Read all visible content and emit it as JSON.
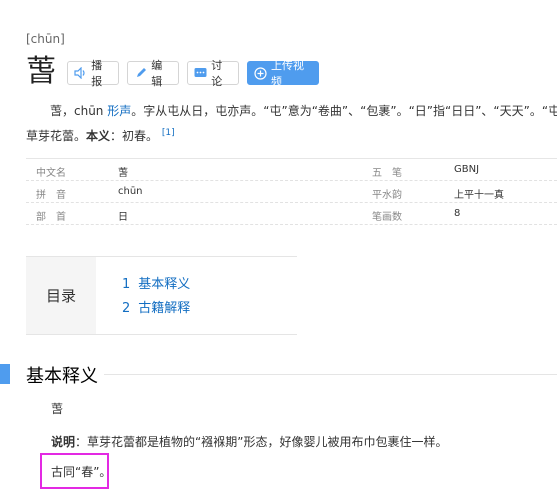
{
  "entry": {
    "pinyin": "[chūn]",
    "character": "萅"
  },
  "buttons": {
    "broadcast": "播报",
    "edit": "编辑",
    "discuss": "讨论",
    "upload": "上传视频"
  },
  "summary": {
    "part1": "萅，chūn",
    "link": "形声",
    "part2": "。字从屯从日，屯亦声。“屯”意为“卷曲”、“包裹”。“日”指“日日”、“天天”。“屯”与“日”联合起来表示“天天在包裹”。本义：初春。",
    "line2_prefix": "草芽花蕾",
    "bold_label": "本义",
    "after_bold": "：初春。",
    "ref": "[1]"
  },
  "summary_line1": "萅，chūn 形声。字从屯从日，屯亦声。“屯”意为“卷曲”、“包裹”。“日”指“日日”、“天天”。“屯”与“日",
  "basic_info": {
    "rows": [
      {
        "name1": "中文名",
        "val1": "萅",
        "name2": "五　笔",
        "val2": "GBNJ"
      },
      {
        "name1": "拼　音",
        "val1": "chūn",
        "name2": "平水韵",
        "val2": "上平十一真"
      },
      {
        "name1": "部　首",
        "val1": "日",
        "name2": "笔画数",
        "val2": "8"
      }
    ]
  },
  "toc": {
    "title": "目录",
    "items": [
      {
        "num": "1",
        "label": "基本释义"
      },
      {
        "num": "2",
        "label": "古籍解释"
      }
    ]
  },
  "section": {
    "title": "基本释义",
    "char": "萅",
    "explain_label": "说明",
    "explain_text": "：草芽花蕾都是植物的“襁褓期”形态，好像婴儿被用布巾包裹住一样。",
    "note": "古同“春”。"
  }
}
